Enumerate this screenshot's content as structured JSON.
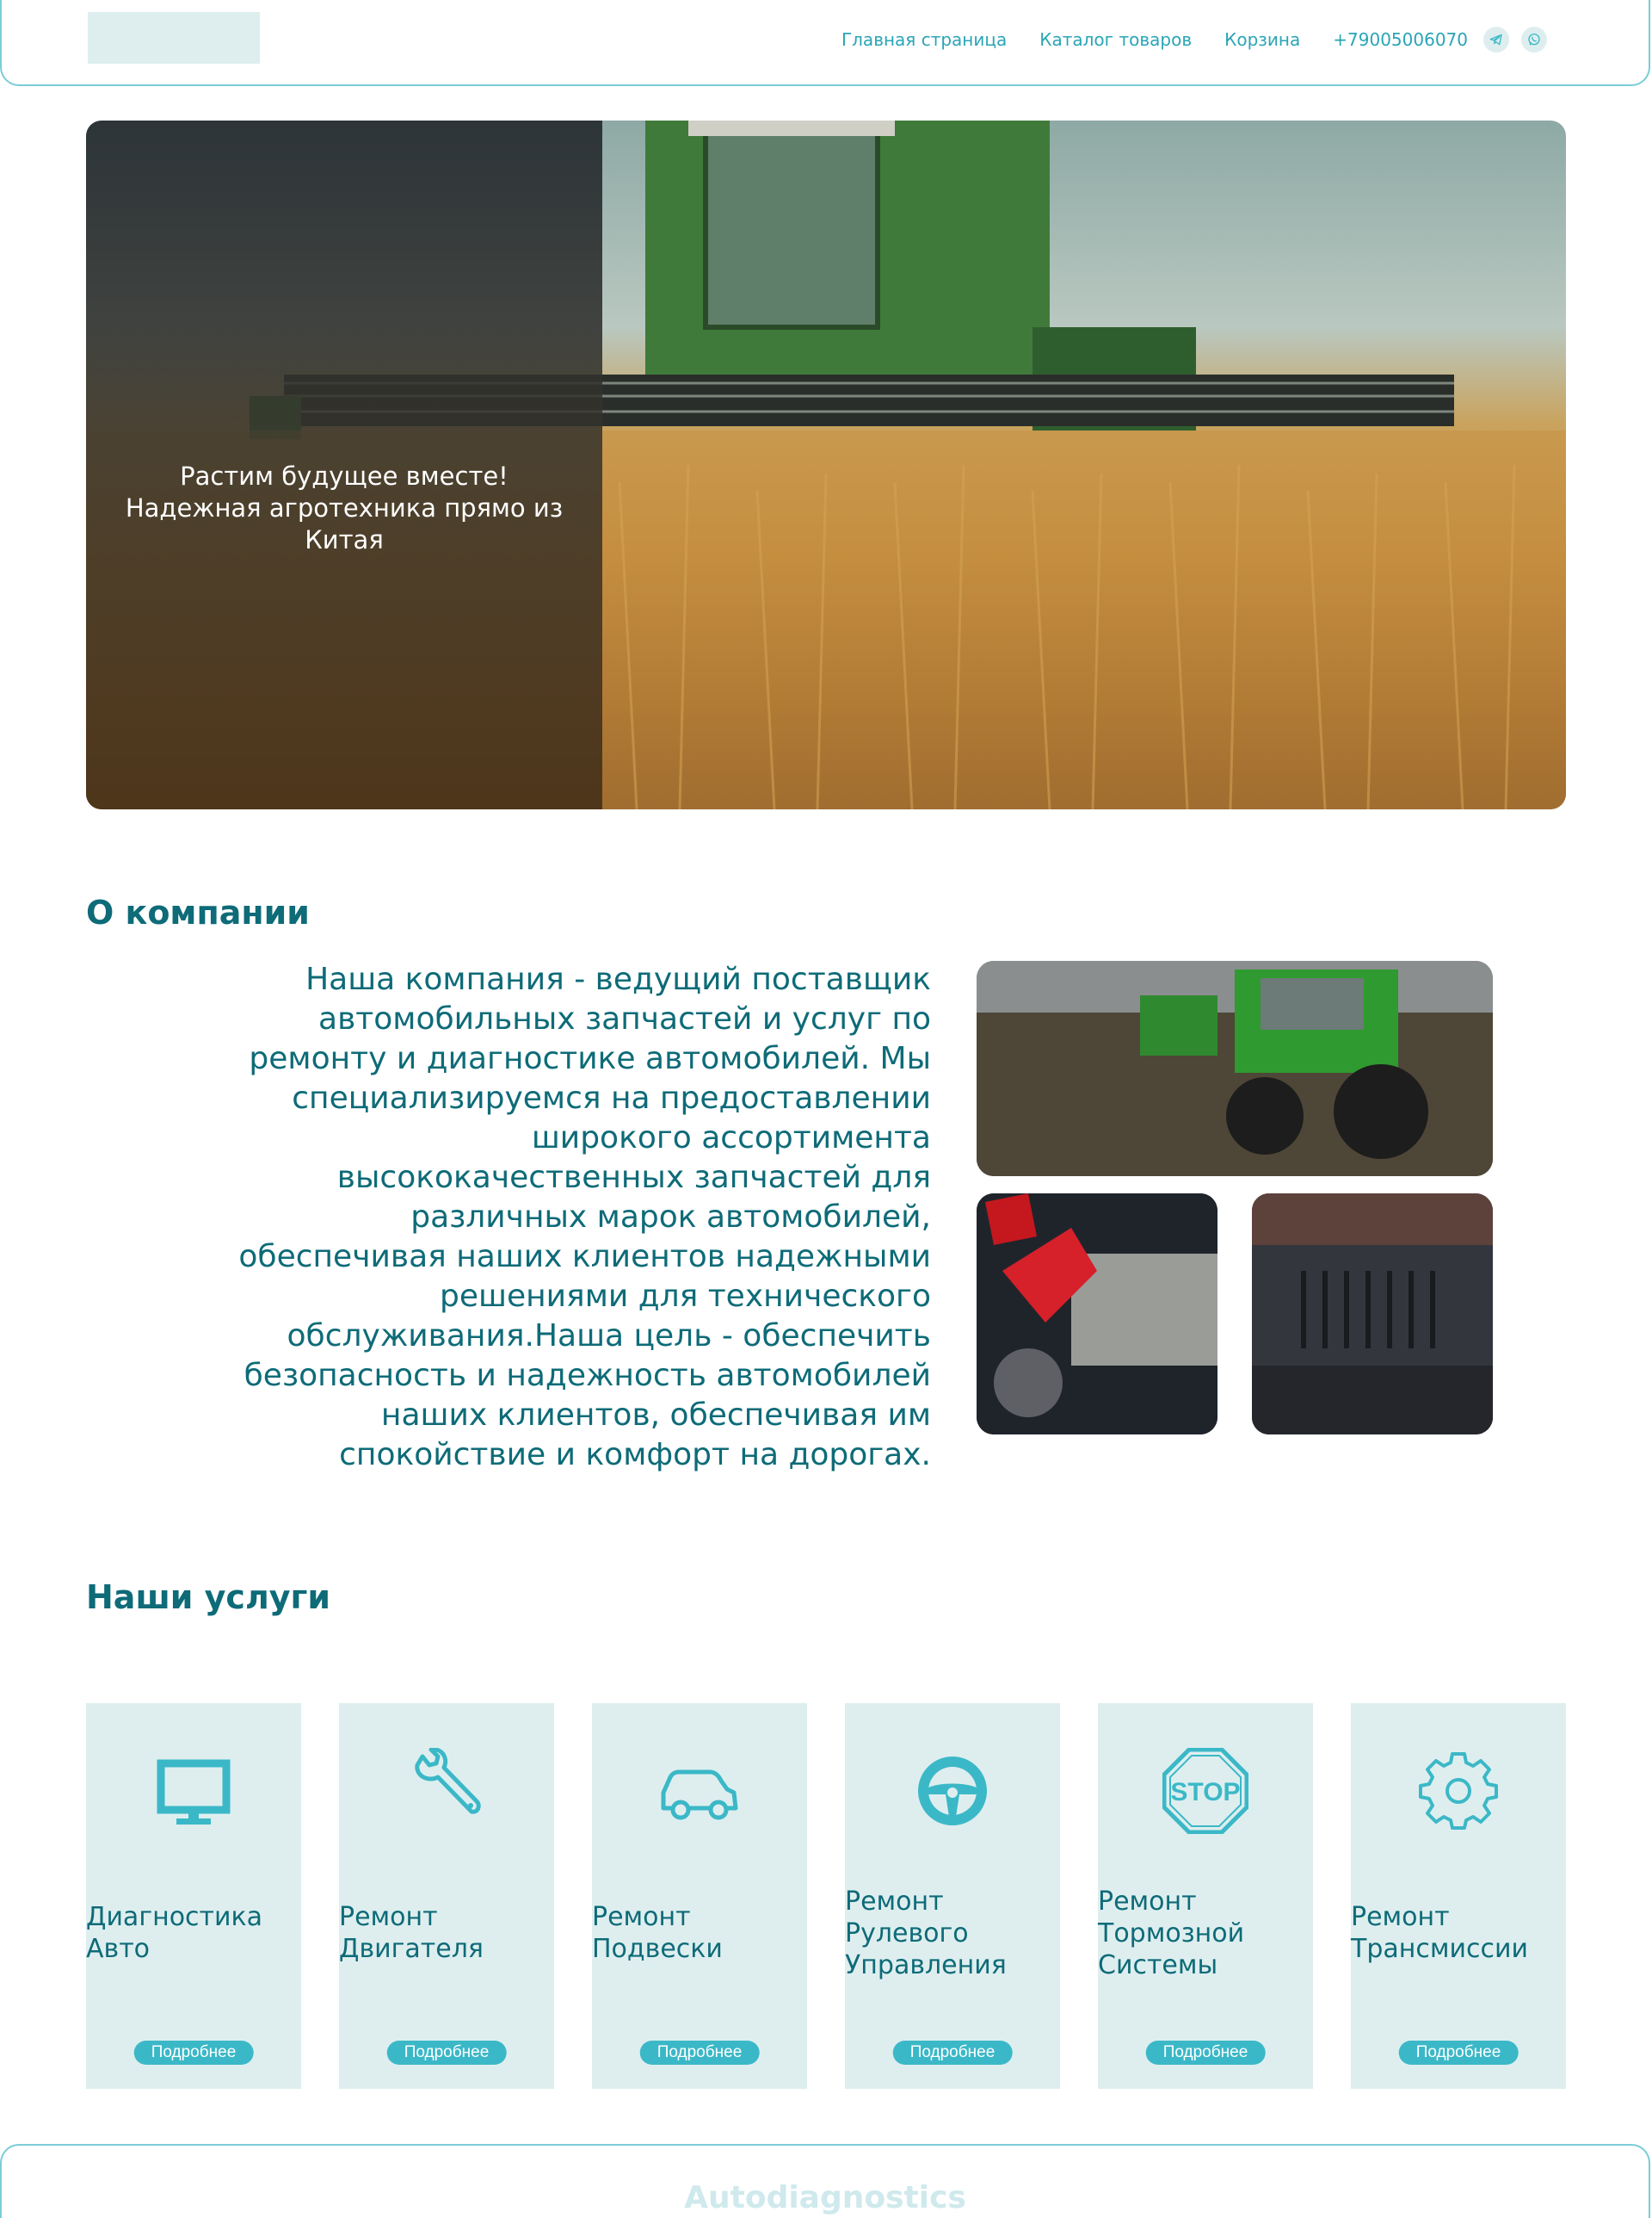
{
  "header": {
    "nav": [
      "Главная страница",
      "Каталог товаров",
      "Корзина"
    ],
    "phone": "+79005006070",
    "social": [
      "telegram-icon",
      "whatsapp-icon"
    ]
  },
  "hero": {
    "line1": "Растим будущее вместе!",
    "line2": "Надежная агротехника прямо из",
    "line3": "Китая"
  },
  "about": {
    "title": "О компании",
    "text": "Наша компания - ведущий поставщик автомобильных запчастей и услуг по ремонту и диагностике автомобилей. Мы специализируемся на предоставлении широкого ассортимента высококачественных запчастей для различных марок автомобилей, обеспечивая наших клиентов надежными решениями для технического обслуживания.Наша цель - обеспечить безопасность и надежность автомобилей наших клиентов, обеспечивая им спокойствие и комфорт на дорогах."
  },
  "services": {
    "title": "Наши услуги",
    "more_label": "Подробнее",
    "items": [
      {
        "icon": "monitor-icon",
        "label": "Диагностика Авто"
      },
      {
        "icon": "wrench-icon",
        "label": "Ремонт Двигателя"
      },
      {
        "icon": "car-icon",
        "label": "Ремонт Подвески"
      },
      {
        "icon": "steering-wheel-icon",
        "label": "Ремонт Рулевого Управления"
      },
      {
        "icon": "stop-sign-icon",
        "label": "Ремонт Тормозной Системы"
      },
      {
        "icon": "gear-icon",
        "label": "Ремонт Трансмиссии"
      }
    ]
  },
  "footer": {
    "brand": "Autodiagnostics"
  },
  "colors": {
    "accent": "#3bb8c7",
    "text": "#0e6b78",
    "card_bg": "#deeeef",
    "border": "#7ccdd8"
  }
}
